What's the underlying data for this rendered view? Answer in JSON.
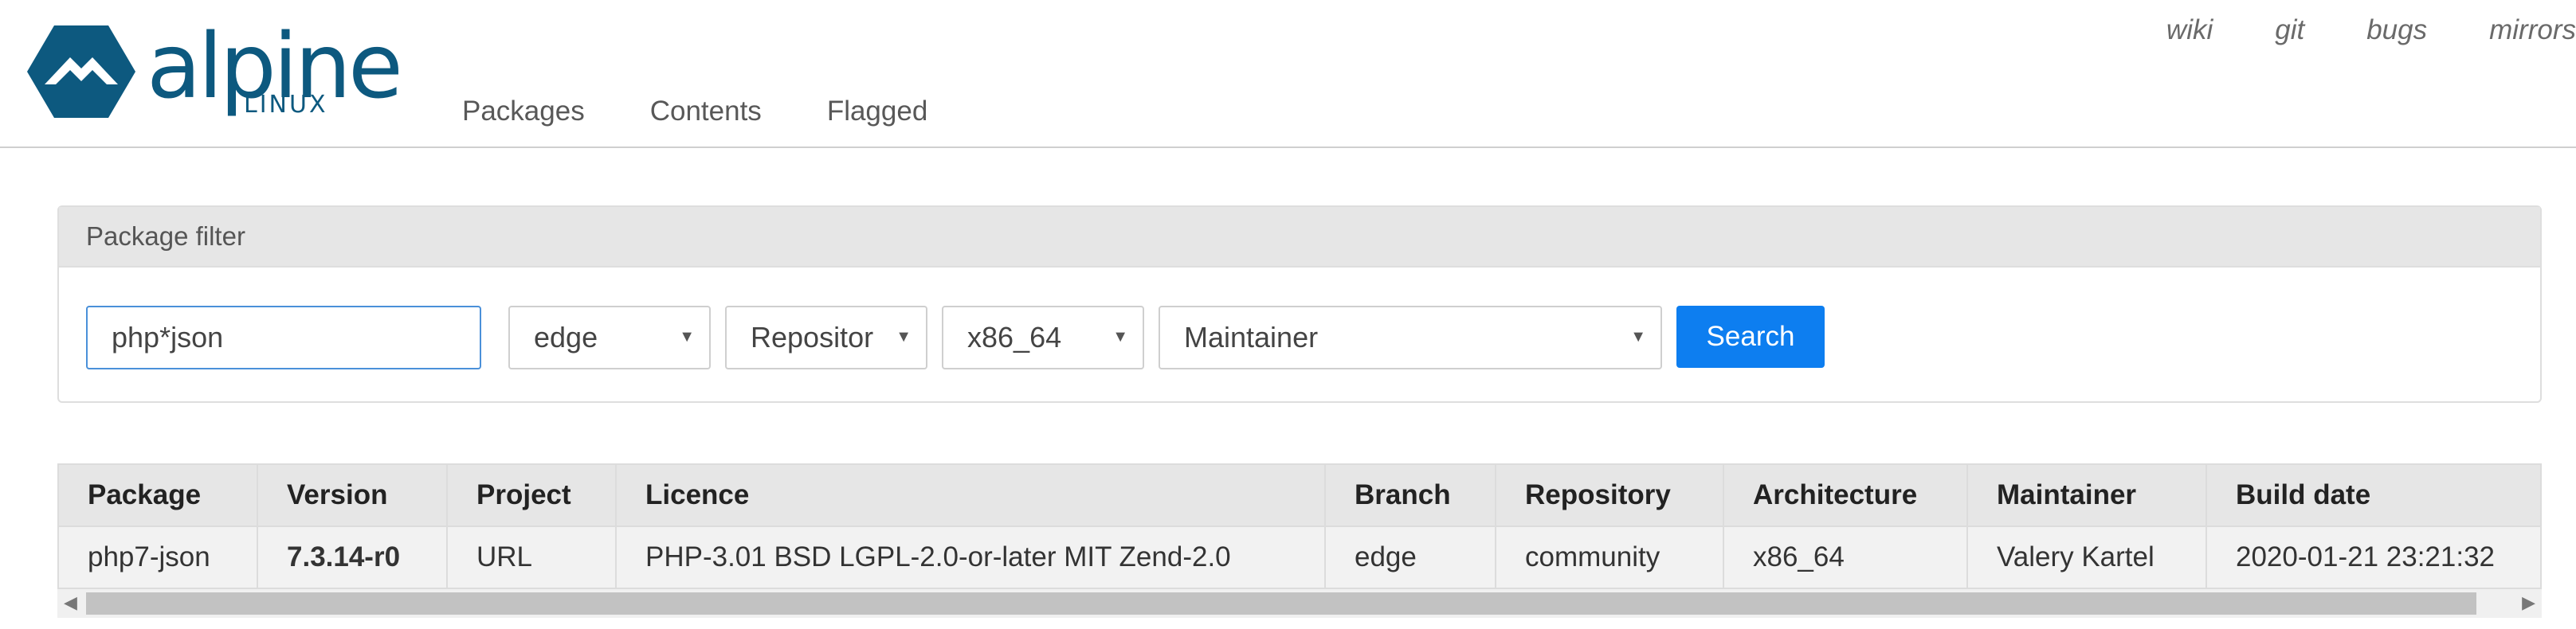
{
  "header": {
    "logo_word": "alpine",
    "logo_sub": "LINUX",
    "main_nav": [
      "Packages",
      "Contents",
      "Flagged"
    ],
    "top_nav": [
      "wiki",
      "git",
      "bugs",
      "mirrors"
    ]
  },
  "filter": {
    "title": "Package filter",
    "name_value": "php*json",
    "branch": "edge",
    "repository": "Repositor",
    "arch": "x86_64",
    "maintainer": "Maintainer",
    "search_label": "Search"
  },
  "table": {
    "headers": [
      "Package",
      "Version",
      "Project",
      "Licence",
      "Branch",
      "Repository",
      "Architecture",
      "Maintainer",
      "Build date"
    ],
    "rows": [
      {
        "package": "php7-json",
        "version": "7.3.14-r0",
        "project": "URL",
        "licence": "PHP-3.01 BSD LGPL-2.0-or-later MIT Zend-2.0",
        "branch": "edge",
        "repository": "community",
        "architecture": "x86_64",
        "maintainer": "Valery Kartel",
        "build_date": "2020-01-21 23:21:32"
      }
    ]
  },
  "icons": {
    "logo": "alpine-mountain-icon",
    "caret": "caret-down-icon",
    "scroll_left": "scroll-left-icon",
    "scroll_right": "scroll-right-icon"
  },
  "colors": {
    "brand": "#0d597f",
    "link": "#2b7bc4",
    "version": "#a3272a",
    "button": "#0d7ef0"
  }
}
